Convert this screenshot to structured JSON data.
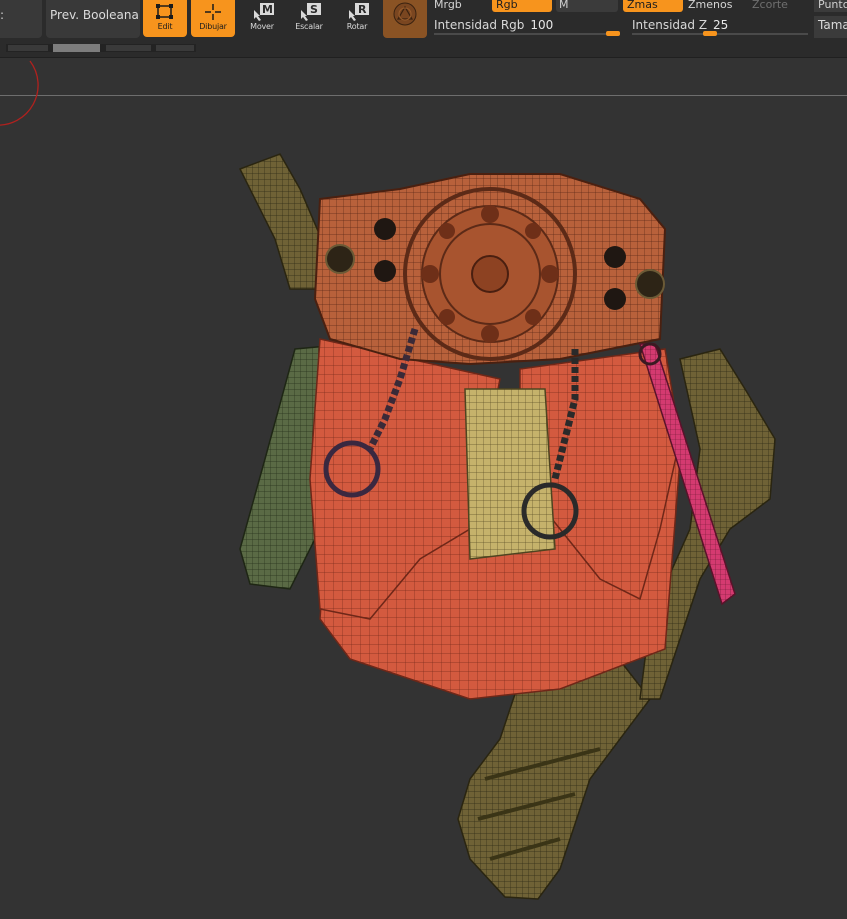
{
  "toolbar": {
    "left_fragment": ":",
    "prev_booleana": "Prev. Booleana",
    "tools": [
      {
        "label": "Edit",
        "icon": "edit-icon",
        "active": true
      },
      {
        "label": "Dibujar",
        "icon": "draw-icon",
        "active": true
      },
      {
        "label": "Mover",
        "icon": "move-icon",
        "key": "M",
        "active": false
      },
      {
        "label": "Escalar",
        "icon": "scale-icon",
        "key": "S",
        "active": false
      },
      {
        "label": "Rotar",
        "icon": "rotate-icon",
        "key": "R",
        "active": false
      }
    ],
    "material_mode_icon": "sphere-icon",
    "modes": {
      "mrgb": "Mrgb",
      "rgb": "Rgb",
      "m": "M",
      "zmas": "Zmas",
      "zmenos": "Zmenos",
      "zcorte": "Zcorte",
      "punto": "Punto",
      "tama": "Tama"
    },
    "sliders": {
      "rgb_intensity": {
        "label": "Intensidad Rgb",
        "value": "100",
        "fraction": 1.0
      },
      "z_intensity": {
        "label": "Intensidad Z",
        "value": "25",
        "fraction": 0.25
      }
    }
  },
  "colors": {
    "accent": "#f7941d",
    "toolbar_bg": "#2b2b2b",
    "viewport_bg": "#333333",
    "mesh_red": "#d0573d",
    "mesh_brown": "#b35f3b",
    "mesh_olive": "#6f6234",
    "mesh_green": "#5a6b46",
    "mesh_magenta": "#d4386f",
    "mesh_yellow": "#c4b06a"
  },
  "viewport": {
    "model_icon": "kilt-armor-model"
  }
}
